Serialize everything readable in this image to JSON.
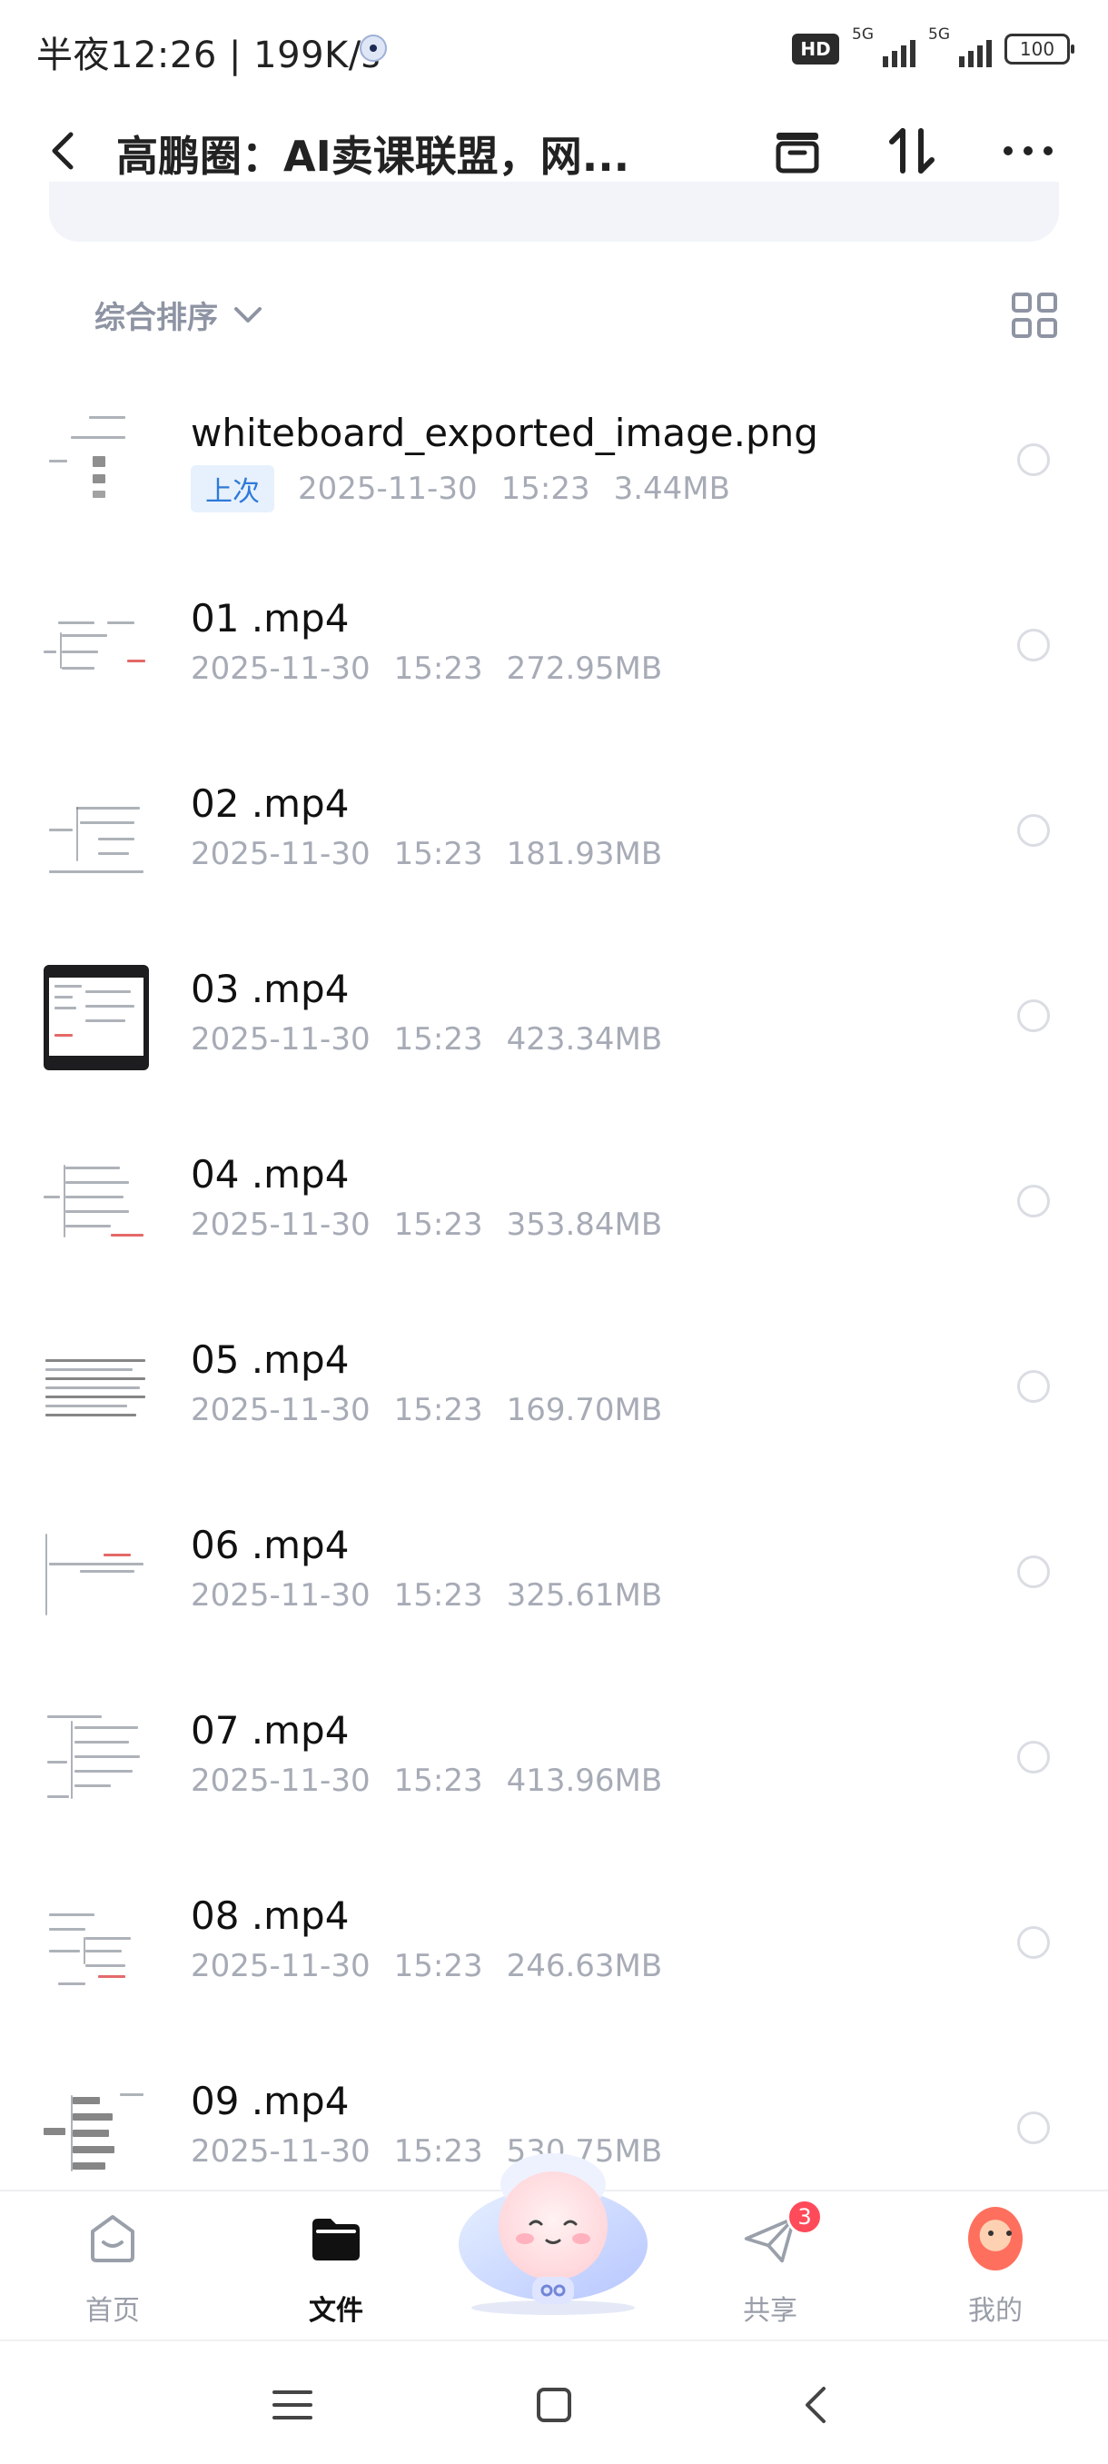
{
  "status_bar": {
    "time_speed": "半夜12:26 | 199K/s",
    "hd": "HD",
    "signal1": "5G",
    "signal2": "5G",
    "battery": "100"
  },
  "app_bar": {
    "title": "高鹏圈：AI卖课联盟，网..."
  },
  "sort": {
    "label": "综合排序"
  },
  "files": [
    {
      "name": "whiteboard_exported_image.png",
      "tag": "上次",
      "date": "2025-11-30",
      "time": "15:23",
      "size": "3.44MB"
    },
    {
      "name": "01 .mp4",
      "tag": "",
      "date": "2025-11-30",
      "time": "15:23",
      "size": "272.95MB"
    },
    {
      "name": "02 .mp4",
      "tag": "",
      "date": "2025-11-30",
      "time": "15:23",
      "size": "181.93MB"
    },
    {
      "name": "03 .mp4",
      "tag": "",
      "date": "2025-11-30",
      "time": "15:23",
      "size": "423.34MB"
    },
    {
      "name": "04 .mp4",
      "tag": "",
      "date": "2025-11-30",
      "time": "15:23",
      "size": "353.84MB"
    },
    {
      "name": "05 .mp4",
      "tag": "",
      "date": "2025-11-30",
      "time": "15:23",
      "size": "169.70MB"
    },
    {
      "name": "06 .mp4",
      "tag": "",
      "date": "2025-11-30",
      "time": "15:23",
      "size": "325.61MB"
    },
    {
      "name": "07 .mp4",
      "tag": "",
      "date": "2025-11-30",
      "time": "15:23",
      "size": "413.96MB"
    },
    {
      "name": "08 .mp4",
      "tag": "",
      "date": "2025-11-30",
      "time": "15:23",
      "size": "246.63MB"
    },
    {
      "name": "09 .mp4",
      "tag": "",
      "date": "2025-11-30",
      "time": "15:23",
      "size": "530.75MB"
    }
  ],
  "bottom_nav": {
    "home": "首页",
    "files": "文件",
    "share": "共享",
    "share_badge": "3",
    "mine": "我的"
  },
  "icons": {
    "back": "back-icon",
    "archive": "archive-icon",
    "sort": "sort-icon",
    "more": "more-icon",
    "grid": "grid-view-icon",
    "home": "home-icon",
    "files": "folder-icon",
    "share": "paper-plane-icon",
    "mine": "avatar-icon",
    "assistant": "mascot-icon"
  },
  "colors": {
    "accent_blue": "#2e7ad8",
    "badge_red": "#ff4a5a",
    "muted_text": "#a7abb6"
  }
}
